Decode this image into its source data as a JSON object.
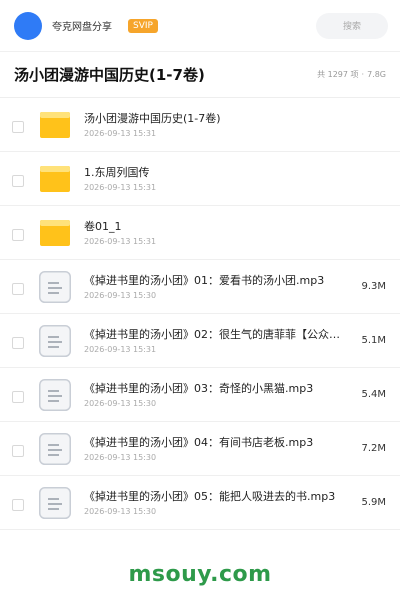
{
  "header": {
    "brand": "夸克网盘分享",
    "badge": "SVIP",
    "search_placeholder": "搜索"
  },
  "folder": {
    "title": "汤小团漫游中国历史(1-7卷)",
    "count_text": "共 1297 项",
    "size_text": "7.8G"
  },
  "files": [
    {
      "type": "folder",
      "name": "汤小团漫游中国历史(1-7卷)",
      "date": "2026-09-13 15:31",
      "size": ""
    },
    {
      "type": "folder",
      "name": "1.东周列国传",
      "date": "2026-09-13 15:31",
      "size": ""
    },
    {
      "type": "folder",
      "name": "卷01_1",
      "date": "2026-09-13 15:31",
      "size": ""
    },
    {
      "type": "file",
      "name": "《掉进书里的汤小团》01：爱看书的汤小团.mp3",
      "date": "2026-09-13 15:30",
      "size": "9.3M"
    },
    {
      "type": "file",
      "name": "《掉进书里的汤小团》02：很生气的唐菲菲【公众号：…",
      "date": "2026-09-13 15:31",
      "size": "5.1M"
    },
    {
      "type": "file",
      "name": "《掉进书里的汤小团》03：奇怪的小黑猫.mp3",
      "date": "2026-09-13 15:30",
      "size": "5.4M"
    },
    {
      "type": "file",
      "name": "《掉进书里的汤小团》04：有间书店老板.mp3",
      "date": "2026-09-13 15:30",
      "size": "7.2M"
    },
    {
      "type": "file",
      "name": "《掉进书里的汤小团》05：能把人吸进去的书.mp3",
      "date": "2026-09-13 15:30",
      "size": "5.9M"
    }
  ],
  "watermark": "msouy.com",
  "colors": {
    "accent_blue": "#2f7bf6",
    "svip_orange": "#f6a52b",
    "folder_yellow": "#ffc21a",
    "watermark_green": "#2e9a4a"
  }
}
